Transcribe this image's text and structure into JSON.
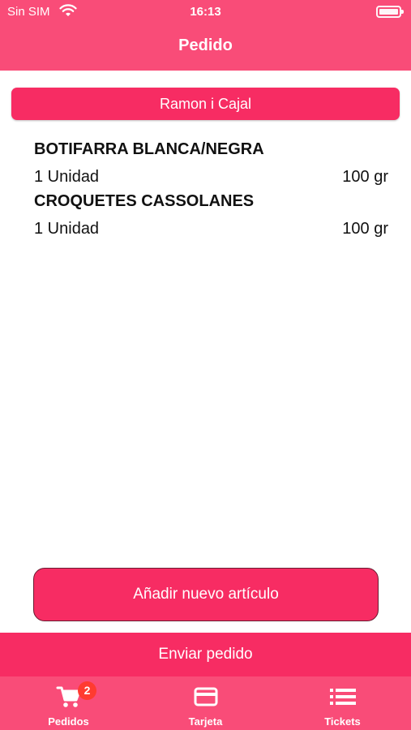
{
  "status_bar": {
    "carrier": "Sin SIM",
    "time": "16:13"
  },
  "nav": {
    "title": "Pedido"
  },
  "store": {
    "name": "Ramon i Cajal"
  },
  "items": [
    {
      "name": "BOTIFARRA BLANCA/NEGRA",
      "quantity": "1 Unidad",
      "weight": "100 gr"
    },
    {
      "name": "CROQUETES CASSOLANES",
      "quantity": "1 Unidad",
      "weight": "100 gr"
    }
  ],
  "actions": {
    "add_label": "Añadir nuevo artículo",
    "send_label": "Enviar pedido"
  },
  "tabs": [
    {
      "label": "Pedidos",
      "icon": "cart-icon",
      "badge": "2"
    },
    {
      "label": "Tarjeta",
      "icon": "credit-card-icon"
    },
    {
      "label": "Tickets",
      "icon": "list-icon"
    }
  ],
  "colors": {
    "primary": "#f94c78",
    "accent": "#f72c63",
    "badge": "#ff3b30"
  }
}
